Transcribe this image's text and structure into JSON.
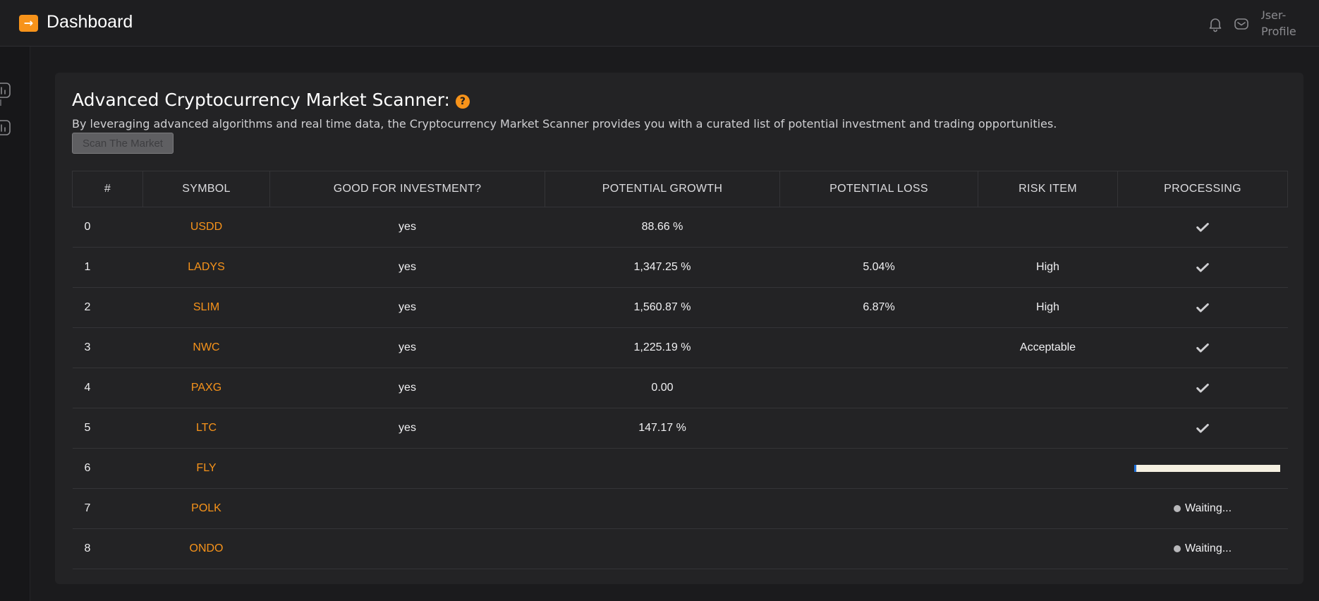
{
  "header": {
    "logo_icon": "arrow-right-icon",
    "title": "Dashboard",
    "notifications_icon": "bell-icon",
    "messages_icon": "mail-icon",
    "profile_label": "User-Profile"
  },
  "sidebar": {
    "items": [
      {
        "icon": "chart-icon"
      },
      {
        "icon": "chart-icon"
      }
    ]
  },
  "scanner": {
    "title": "Advanced Cryptocurrency Market Scanner:",
    "help_icon": "question-icon",
    "description": "By leveraging advanced algorithms and real time data, the Cryptocurrency Market Scanner provides you with a curated list of potential investment and trading opportunities.",
    "scan_button": "Scan The Market",
    "columns": [
      "#",
      "SYMBOL",
      "GOOD FOR INVESTMENT?",
      "POTENTIAL GROWTH",
      "POTENTIAL LOSS",
      "RISK ITEM",
      "PROCESSING"
    ],
    "rows": [
      {
        "index": "0",
        "symbol": "USDD",
        "good": "yes",
        "growth": "88.66 %",
        "loss": "",
        "risk": "",
        "status": "done"
      },
      {
        "index": "1",
        "symbol": "LADYS",
        "good": "yes",
        "growth": "1,347.25 %",
        "loss": "5.04%",
        "risk": "High",
        "status": "done"
      },
      {
        "index": "2",
        "symbol": "SLIM",
        "good": "yes",
        "growth": "1,560.87 %",
        "loss": "6.87%",
        "risk": "High",
        "status": "done"
      },
      {
        "index": "3",
        "symbol": "NWC",
        "good": "yes",
        "growth": "1,225.19 %",
        "loss": "",
        "risk": "Acceptable",
        "status": "done"
      },
      {
        "index": "4",
        "symbol": "PAXG",
        "good": "yes",
        "growth": "0.00",
        "loss": "",
        "risk": "",
        "status": "done"
      },
      {
        "index": "5",
        "symbol": "LTC",
        "good": "yes",
        "growth": "147.17 %",
        "loss": "",
        "risk": "",
        "status": "done"
      },
      {
        "index": "6",
        "symbol": "FLY",
        "good": "",
        "growth": "",
        "loss": "",
        "risk": "",
        "status": "processing",
        "progress_fraction": 0.01
      },
      {
        "index": "7",
        "symbol": "POLK",
        "good": "",
        "growth": "",
        "loss": "",
        "risk": "",
        "status": "waiting",
        "status_label": "Waiting..."
      },
      {
        "index": "8",
        "symbol": "ONDO",
        "good": "",
        "growth": "",
        "loss": "",
        "risk": "",
        "status": "waiting",
        "status_label": "Waiting..."
      }
    ]
  },
  "colors": {
    "accent": "#f7931a",
    "background": "#1b1b1d",
    "card": "#232325",
    "progress_fill": "#1e6fd9",
    "progress_track": "#f5f0e1"
  }
}
